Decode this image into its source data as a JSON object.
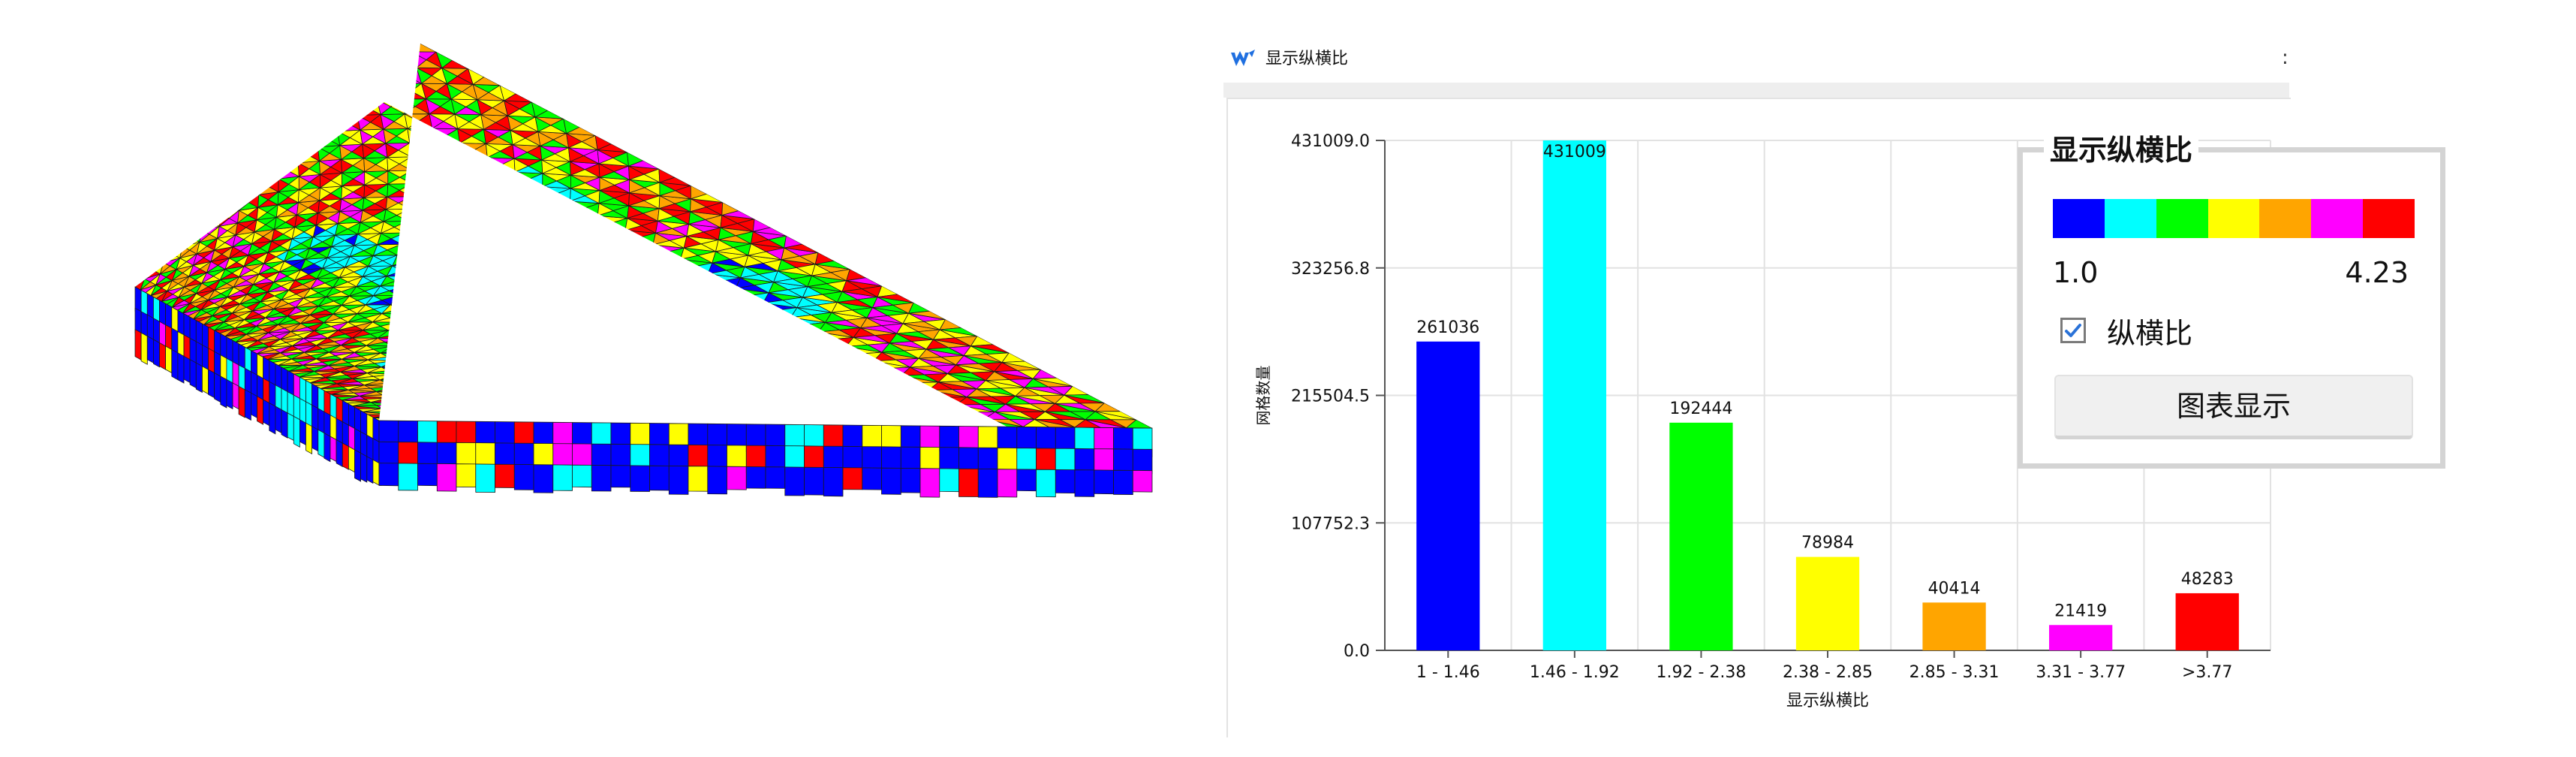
{
  "window": {
    "title": "显示纵横比",
    "close_glyph": ":"
  },
  "legend": {
    "title": "显示纵横比",
    "min_label": "1.0",
    "max_label": "4.23",
    "colors": [
      "#0000ff",
      "#00ffff",
      "#00ff00",
      "#ffff00",
      "#ffa500",
      "#ff00ff",
      "#ff0000"
    ],
    "checkbox_label": "纵横比",
    "checkbox_checked": true,
    "button_label": "图表显示"
  },
  "mesh_colors": [
    "#0000ff",
    "#00ffff",
    "#00ff00",
    "#ffff00",
    "#ffa500",
    "#ff00ff",
    "#ff0000"
  ],
  "chart_data": {
    "type": "bar",
    "title": "",
    "xlabel": "显示纵横比",
    "ylabel": "网格数量",
    "categories": [
      "1 - 1.46",
      "1.46 - 1.92",
      "1.92 - 2.38",
      "2.38 - 2.85",
      "2.85 - 3.31",
      "3.31 - 3.77",
      ">3.77"
    ],
    "values": [
      261036,
      431009,
      192444,
      78984,
      40414,
      21419,
      48283
    ],
    "colors": [
      "#0000ff",
      "#00ffff",
      "#00ff00",
      "#ffff00",
      "#ffa500",
      "#ff00ff",
      "#ff0000"
    ],
    "ylim": [
      0.0,
      431009.0
    ],
    "yticks": [
      "0.0",
      "107752.3",
      "215504.5",
      "323256.8",
      "431009.0"
    ],
    "grid": true
  }
}
